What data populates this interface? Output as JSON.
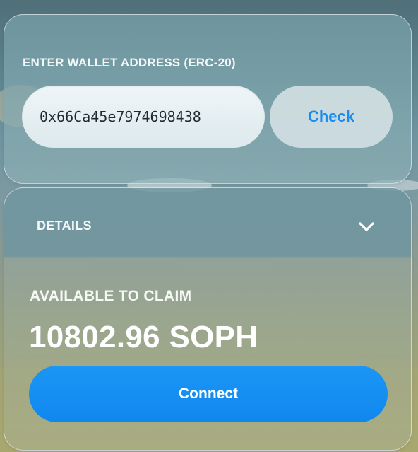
{
  "wallet": {
    "label": "ENTER WALLET ADDRESS (ERC-20)",
    "address_value": "0x66Ca45e7974698438",
    "check_label": "Check"
  },
  "details": {
    "label": "DETAILS",
    "toggle_icon": "chevron-down-icon"
  },
  "claim": {
    "label": "AVAILABLE TO CLAIM",
    "amount": "10802.96 SOPH"
  },
  "actions": {
    "connect_label": "Connect"
  },
  "colors": {
    "accent": "#1a8cf0",
    "connect_button": "#1187ee",
    "text_light": "#f4f8f9"
  }
}
